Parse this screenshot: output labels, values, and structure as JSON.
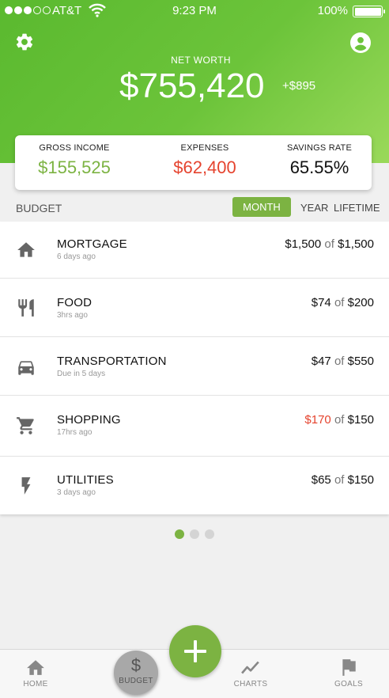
{
  "status_bar": {
    "carrier": "AT&T",
    "time": "9:23 PM",
    "battery": "100%",
    "signal_bars_filled": 3,
    "signal_bars_total": 5
  },
  "header": {
    "net_worth_label": "NET WORTH",
    "net_worth_value": "$755,420",
    "net_worth_change": "+$895"
  },
  "summary": {
    "gross_income_label": "GROSS INCOME",
    "gross_income_value": "$155,525",
    "expenses_label": "EXPENSES",
    "expenses_value": "$62,400",
    "savings_rate_label": "SAVINGS RATE",
    "savings_rate_value": "65.55%"
  },
  "budget": {
    "title": "BUDGET",
    "tabs": {
      "month": "MONTH",
      "year": "YEAR",
      "lifetime": "LIFETIME",
      "selected": "MONTH"
    },
    "items": [
      {
        "title": "MORTGAGE",
        "subtitle": "6 days ago",
        "spent": "$1,500",
        "of": "of",
        "limit": "$1,500",
        "over_budget": false,
        "icon": "home-icon"
      },
      {
        "title": "FOOD",
        "subtitle": "3hrs ago",
        "spent": "$74",
        "of": "of",
        "limit": "$200",
        "over_budget": false,
        "icon": "utensils-icon"
      },
      {
        "title": "TRANSPORTATION",
        "subtitle": "Due in 5 days",
        "spent": "$47",
        "of": "of",
        "limit": "$550",
        "over_budget": false,
        "icon": "car-icon"
      },
      {
        "title": "SHOPPING",
        "subtitle": "17hrs ago",
        "spent": "$170",
        "of": "of",
        "limit": "$150",
        "over_budget": true,
        "icon": "cart-icon"
      },
      {
        "title": "UTILITIES",
        "subtitle": "3 days ago",
        "spent": "$65",
        "of": "of",
        "limit": "$150",
        "over_budget": false,
        "icon": "bolt-icon"
      }
    ]
  },
  "pager": {
    "pages": 3,
    "current": 1
  },
  "tabbar": {
    "home": "HOME",
    "budget": "BUDGET",
    "budget_symbol": "$",
    "charts": "CHARTS",
    "goals": "GOALS",
    "fab": "add-icon"
  },
  "colors": {
    "brand_green": "#7cb342",
    "income_green": "#7cb342",
    "expense_red": "#e5432e"
  }
}
